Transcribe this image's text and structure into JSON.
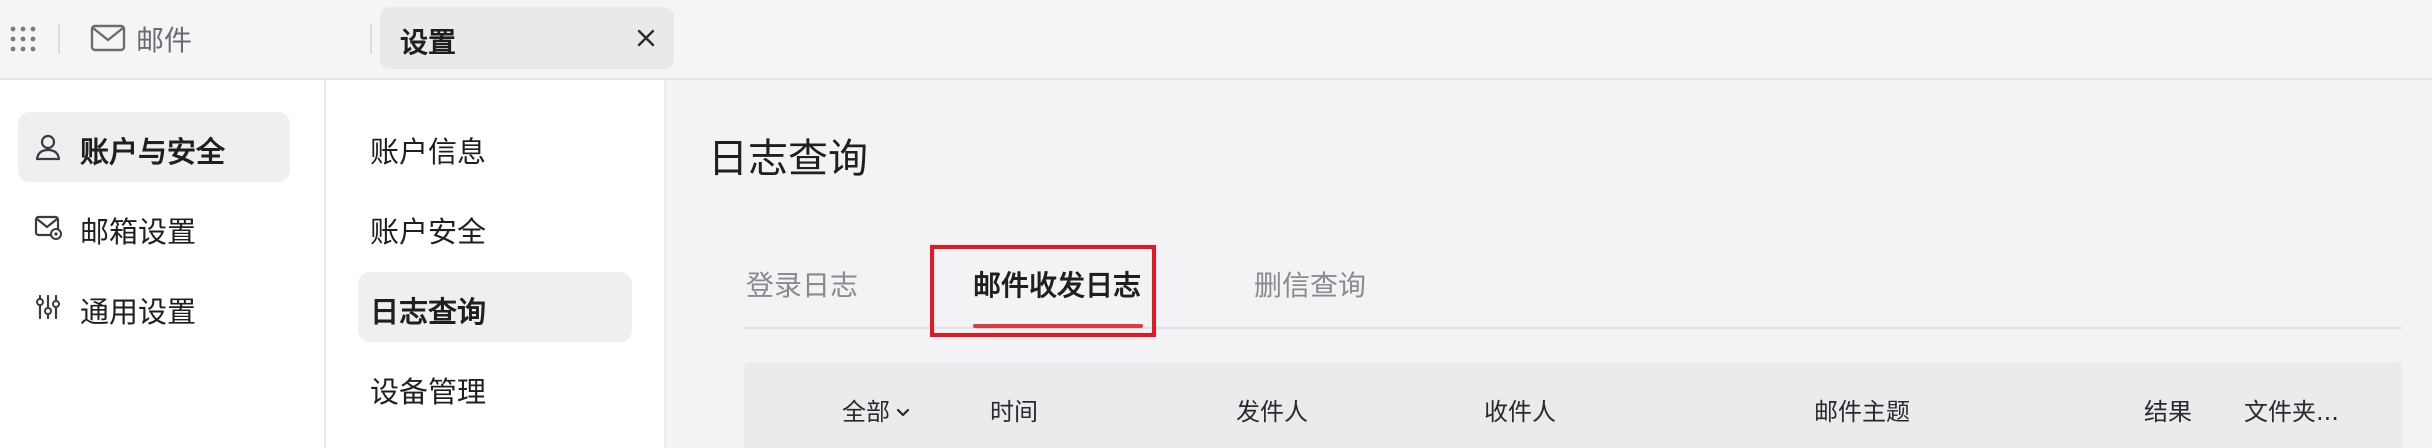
{
  "topbar": {
    "app_label": "邮件",
    "active_tab": "设置"
  },
  "left_nav": [
    {
      "label": "账户与安全",
      "icon": "user-icon",
      "active": true
    },
    {
      "label": "邮箱设置",
      "icon": "mailbox-settings-icon",
      "active": false
    },
    {
      "label": "通用设置",
      "icon": "sliders-icon",
      "active": false
    }
  ],
  "sub_nav": [
    {
      "label": "账户信息",
      "active": false
    },
    {
      "label": "账户安全",
      "active": false
    },
    {
      "label": "日志查询",
      "active": true
    },
    {
      "label": "设备管理",
      "active": false
    }
  ],
  "main": {
    "title": "日志查询",
    "tabs": [
      {
        "label": "登录日志",
        "active": false
      },
      {
        "label": "邮件收发日志",
        "active": true
      },
      {
        "label": "删信查询",
        "active": false
      }
    ],
    "table_columns": [
      "全部",
      "时间",
      "发件人",
      "收件人",
      "邮件主题",
      "结果",
      "文件夹..."
    ]
  },
  "colors": {
    "accent_underline": "#e0393e",
    "highlight_border": "#e3191f",
    "active_bg": "#efeff2"
  }
}
